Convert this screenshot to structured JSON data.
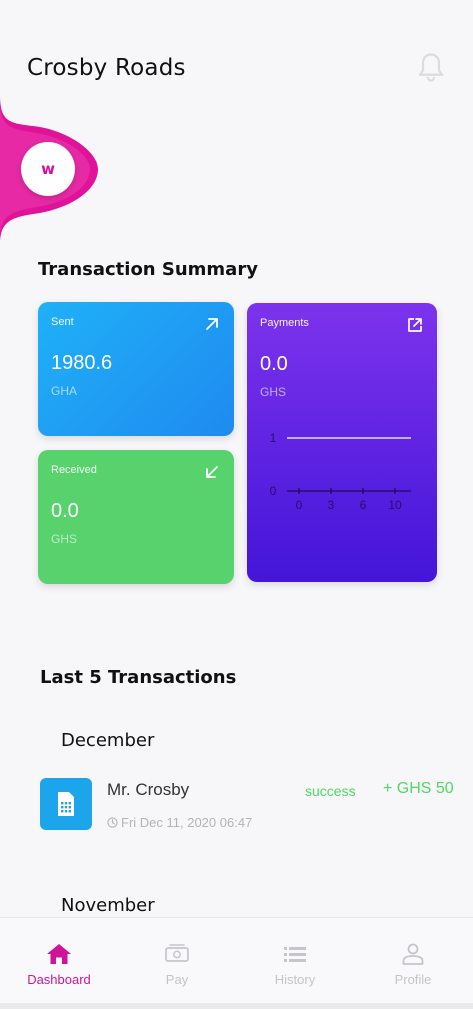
{
  "header": {
    "title": "Crosby Roads",
    "notification_icon": "bell-icon"
  },
  "avatar": {
    "initial": "w",
    "color": "#d0149a"
  },
  "transaction_summary": {
    "title": "Transaction Summary",
    "sent": {
      "label": "Sent",
      "amount": "1980.6",
      "currency": "GHA",
      "icon": "arrow-up-right-icon"
    },
    "received": {
      "label": "Received",
      "amount": "0.0",
      "currency": "GHS",
      "icon": "arrow-down-left-icon"
    },
    "payments": {
      "label": "Payments",
      "amount": "0.0",
      "currency": "GHS",
      "icon": "external-link-icon",
      "chart_data": {
        "type": "line",
        "y_ticks": [
          "1",
          "0"
        ],
        "x_ticks": [
          "0",
          "3",
          "6",
          "10"
        ],
        "series": [
          {
            "values": [
              1,
              1,
              1,
              1
            ]
          }
        ],
        "grid": false
      }
    }
  },
  "last_transactions": {
    "title": "Last 5 Transactions",
    "groups": [
      {
        "month": "December",
        "items": [
          {
            "name": "Mr. Crosby",
            "status": "success",
            "amount": "+ GHS 50",
            "date": "Fri Dec 11, 2020 06:47"
          }
        ]
      },
      {
        "month": "November"
      }
    ]
  },
  "nav": {
    "items": [
      {
        "label": "Dashboard",
        "icon": "home-icon",
        "active": true
      },
      {
        "label": "Pay",
        "icon": "money-icon",
        "active": false
      },
      {
        "label": "History",
        "icon": "list-icon",
        "active": false
      },
      {
        "label": "Profile",
        "icon": "person-icon",
        "active": false
      }
    ]
  },
  "colors": {
    "accent": "#d0149a",
    "sent": "#1f9af3",
    "received": "#57d26d",
    "payments": "#6a26e6",
    "success": "#4cd964"
  }
}
